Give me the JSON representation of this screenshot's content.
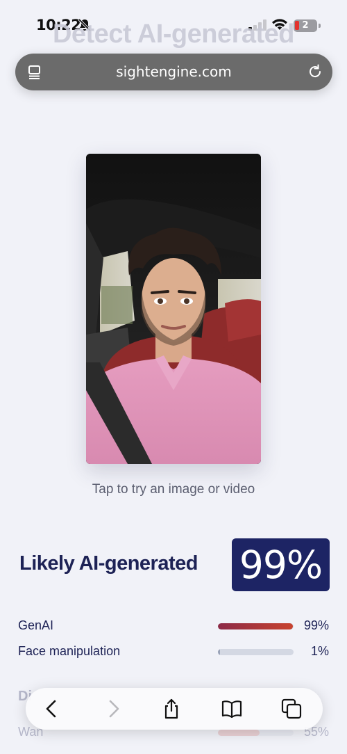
{
  "status_bar": {
    "time": "10:22",
    "battery_level": "2",
    "icons": [
      "bell-slash-icon",
      "signal-icon",
      "wifi-icon",
      "battery-icon"
    ]
  },
  "page": {
    "background_heading": "Detect AI-generated"
  },
  "browser": {
    "url": "sightengine.com",
    "icons": [
      "reader-icon",
      "reload-icon"
    ]
  },
  "upload": {
    "caption": "Tap to try an image or video"
  },
  "result": {
    "verdict": "Likely AI-generated",
    "score": "99%",
    "metrics": [
      {
        "label": "GenAI",
        "value": "99%",
        "fraction": 0.99,
        "color": "#b53a3a"
      },
      {
        "label": "Face manipulation",
        "value": "1%",
        "fraction": 0.01,
        "color": "#9aa3b8"
      }
    ],
    "section_partial": "Di",
    "generators": [
      {
        "label": "Wan",
        "value": "55%",
        "fraction": 0.55,
        "color": "#d77a7a"
      }
    ]
  },
  "toolbar": {
    "icons": [
      "back-icon",
      "forward-icon",
      "share-icon",
      "bookmarks-icon",
      "tabs-icon"
    ]
  },
  "colors": {
    "accent": "#1d2464",
    "genai_bar_start": "#8c2a47",
    "genai_bar_end": "#c8432f"
  }
}
